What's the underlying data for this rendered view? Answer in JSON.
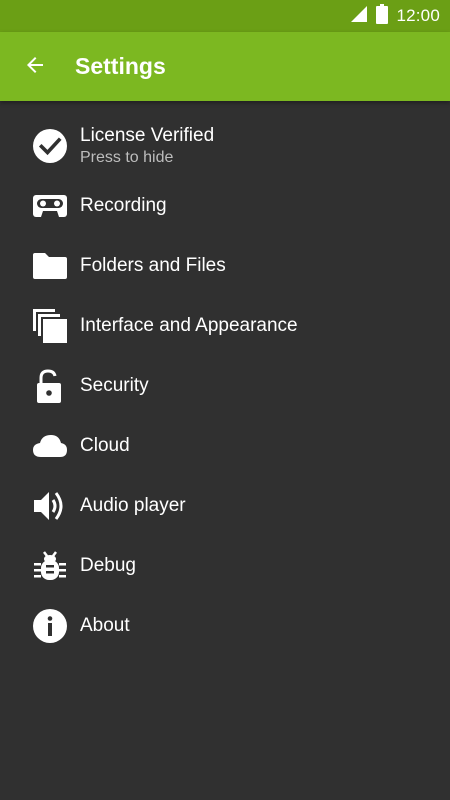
{
  "status_bar": {
    "time": "12:00",
    "icons": [
      "signal-icon",
      "battery-icon"
    ]
  },
  "app_bar": {
    "back_icon": "arrow-back-icon",
    "title": "Settings",
    "color": "#7cb821",
    "status_color": "#6b9f15"
  },
  "settings": {
    "items": [
      {
        "icon": "check-circle-icon",
        "label": "License Verified",
        "subtitle": "Press to hide"
      },
      {
        "icon": "cassette-icon",
        "label": "Recording"
      },
      {
        "icon": "folder-icon",
        "label": "Folders and Files"
      },
      {
        "icon": "layers-icon",
        "label": "Interface and Appearance"
      },
      {
        "icon": "lock-open-icon",
        "label": "Security"
      },
      {
        "icon": "cloud-icon",
        "label": "Cloud"
      },
      {
        "icon": "speaker-icon",
        "label": "Audio player"
      },
      {
        "icon": "bug-icon",
        "label": "Debug"
      },
      {
        "icon": "info-icon",
        "label": "About"
      }
    ]
  },
  "background_color": "#303030"
}
